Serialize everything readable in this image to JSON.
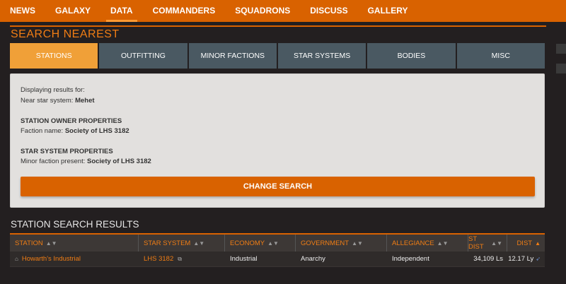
{
  "nav": {
    "items": [
      "NEWS",
      "GALAXY",
      "DATA",
      "COMMANDERS",
      "SQUADRONS",
      "DISCUSS",
      "GALLERY"
    ],
    "active_index": 2
  },
  "header": {
    "title": "SEARCH NEAREST"
  },
  "tabs": [
    "STATIONS",
    "OUTFITTING",
    "MINOR FACTIONS",
    "STAR SYSTEMS",
    "BODIES",
    "MISC"
  ],
  "panel": {
    "displaying": "Displaying results for:",
    "near_label": "Near star system:",
    "near_value": "Mehet",
    "owner_heading": "STATION OWNER PROPERTIES",
    "faction_label": "Faction name:",
    "faction_value": "Society of LHS 3182",
    "system_heading": "STAR SYSTEM PROPERTIES",
    "minor_label": "Minor faction present:",
    "minor_value": "Society of LHS 3182",
    "button": "CHANGE SEARCH"
  },
  "results": {
    "title": "STATION SEARCH RESULTS",
    "columns": [
      "STATION",
      "STAR SYSTEM",
      "ECONOMY",
      "GOVERNMENT",
      "ALLEGIANCE",
      "ST DIST",
      "DIST"
    ],
    "rows": [
      {
        "station": "Howarth's Industrial",
        "system": "LHS 3182",
        "economy": "Industrial",
        "government": "Anarchy",
        "allegiance": "Independent",
        "st_dist": "34,109 Ls",
        "dist": "12.17 Ly"
      }
    ]
  },
  "colors": {
    "accent": "#d96200",
    "tab_active": "#f0a038",
    "tab_inactive": "#4a5962",
    "background": "#231f20"
  }
}
